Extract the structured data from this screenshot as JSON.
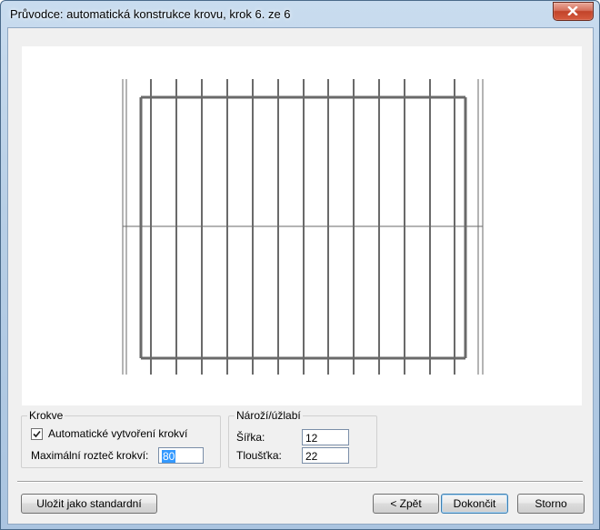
{
  "window": {
    "title": "Průvodce: automatická konstrukce krovu, krok 6. ze 6"
  },
  "rafters": {
    "legend": "Krokve",
    "auto_create_label": "Automatické vytvoření krokví",
    "auto_create_checked": true,
    "max_spacing_label": "Maximální rozteč krokví:",
    "max_spacing_value": "80"
  },
  "corner": {
    "legend": "Nároží/úžlabí",
    "width_label": "Šířka:",
    "width_value": "12",
    "thickness_label": "Tloušťka:",
    "thickness_value": "22"
  },
  "buttons": {
    "save_default": "Uložit jako standardní",
    "back": "< Zpět",
    "finish": "Dokončit",
    "cancel": "Storno"
  },
  "colors": {
    "preview_lines": "#6a6a6a",
    "selection": "#3399ff"
  }
}
